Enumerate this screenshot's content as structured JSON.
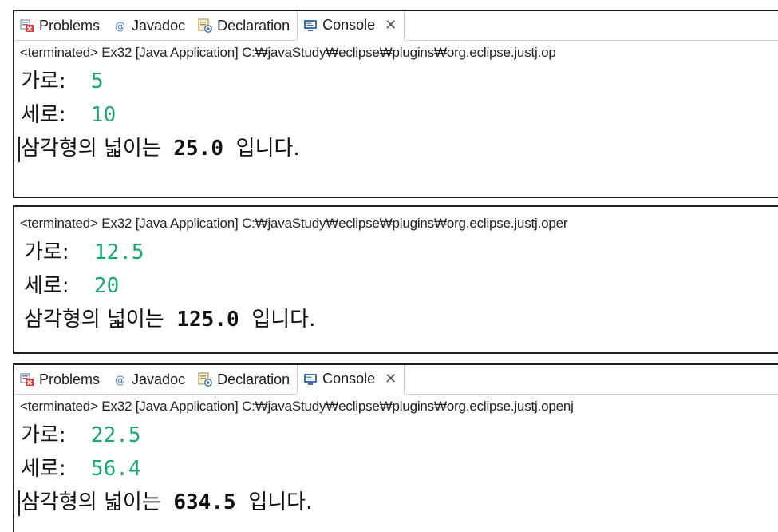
{
  "panels": [
    {
      "tabs": {
        "problems": "Problems",
        "javadoc": "Javadoc",
        "declaration": "Declaration",
        "console": "Console"
      },
      "status": "<terminated> Ex32 [Java Application] C:₩javaStudy₩eclipse₩plugins₩org.eclipse.justj.op",
      "width_label": "가로:",
      "width_value": "5",
      "height_label": "세로:",
      "height_value": "10",
      "result_prefix": "삼각형의 넓이는",
      "result_value": "25.0",
      "result_suffix": "입니다."
    },
    {
      "status": "<terminated> Ex32 [Java Application] C:₩javaStudy₩eclipse₩plugins₩org.eclipse.justj.oper",
      "width_label": "가로:",
      "width_value": "12.5",
      "height_label": "세로:",
      "height_value": "20",
      "result_prefix": "삼각형의 넓이는",
      "result_value": "125.0",
      "result_suffix": "입니다."
    },
    {
      "tabs": {
        "problems": "Problems",
        "javadoc": "Javadoc",
        "declaration": "Declaration",
        "console": "Console"
      },
      "status": "<terminated> Ex32 [Java Application] C:₩javaStudy₩eclipse₩plugins₩org.eclipse.justj.openj",
      "width_label": "가로:",
      "width_value": "22.5",
      "height_label": "세로:",
      "height_value": "56.4",
      "result_prefix": "삼각형의 넓이는",
      "result_value": "634.5",
      "result_suffix": "입니다."
    }
  ],
  "icons": {
    "problems": "problems-icon",
    "javadoc": "javadoc-at-icon",
    "declaration": "declaration-icon",
    "console": "console-icon",
    "close": "close-icon"
  },
  "colors": {
    "input_text": "#18a96b",
    "output_text": "#111111",
    "panel_border": "#1f1f1f"
  }
}
